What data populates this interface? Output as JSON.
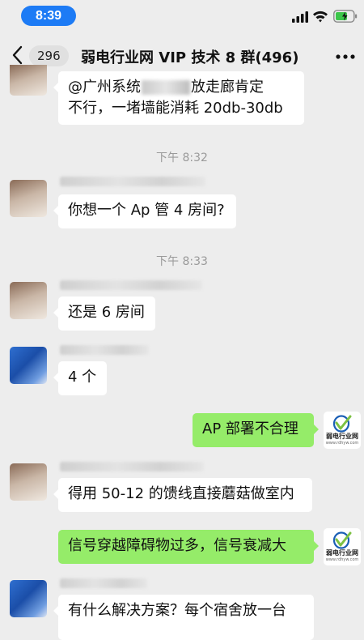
{
  "status": {
    "time": "8:39"
  },
  "nav": {
    "unread": "296",
    "title": "弱电行业网 VIP 技术 8 群(496)"
  },
  "messages": [
    {
      "side": "left",
      "avatar": "brown",
      "text_a": "@广州系统",
      "text_b": "放走廊肯定",
      "text_c": "不行，一堵墙能消耗 20db-30db"
    },
    {
      "timestamp": "下午 8:32"
    },
    {
      "side": "left",
      "avatar": "brown",
      "text": "你想一个 Ap 管 4 房间?"
    },
    {
      "timestamp": "下午 8:33"
    },
    {
      "side": "left",
      "avatar": "brown",
      "text": "还是 6 房间"
    },
    {
      "side": "left",
      "avatar": "blue",
      "text": "4 个"
    },
    {
      "side": "right",
      "avatar": "logo",
      "text": "AP 部署不合理"
    },
    {
      "side": "left",
      "avatar": "brown",
      "text": "得用 50-12 的馈线直接蘑菇做室内"
    },
    {
      "side": "right",
      "avatar": "logo",
      "text": "信号穿越障碍物过多，信号衰减大"
    },
    {
      "side": "left",
      "avatar": "blue",
      "text": "有什么解决方案？每个宿舍放一台"
    }
  ],
  "logo": {
    "name": "弱电行业网",
    "url": "www.rdhyw.com",
    "color": "#1b5fb5",
    "accent": "#7cc142"
  },
  "colors": {
    "accent": "#1d7bf5",
    "self_bubble": "#95ec69",
    "background": "#ededed"
  }
}
